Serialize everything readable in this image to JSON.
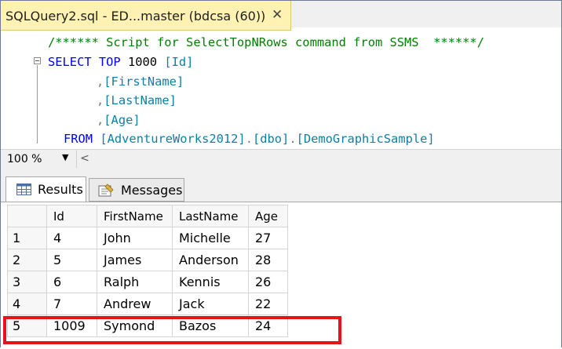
{
  "document_tab": {
    "title": "SQLQuery2.sql - ED...master (bdcsa (60))",
    "close_label": "✕"
  },
  "editor": {
    "lines": [
      {
        "parts": [
          {
            "cls": "cmt",
            "text": "/****** Script for SelectTopNRows command from SSMS  ******/"
          }
        ]
      },
      {
        "parts": [
          {
            "cls": "kw",
            "text": "SELECT"
          },
          {
            "cls": "plain",
            "text": " "
          },
          {
            "cls": "kw",
            "text": "TOP"
          },
          {
            "cls": "plain",
            "text": " 1000 "
          },
          {
            "cls": "br",
            "text": "[Id]"
          }
        ]
      },
      {
        "parts": [
          {
            "cls": "gray",
            "text": ","
          },
          {
            "cls": "br",
            "text": "[FirstName]"
          }
        ]
      },
      {
        "parts": [
          {
            "cls": "gray",
            "text": ","
          },
          {
            "cls": "br",
            "text": "[LastName]"
          }
        ]
      },
      {
        "parts": [
          {
            "cls": "gray",
            "text": ","
          },
          {
            "cls": "br",
            "text": "[Age]"
          }
        ]
      },
      {
        "parts": [
          {
            "cls": "kw",
            "text": "FROM"
          },
          {
            "cls": "plain",
            "text": " "
          },
          {
            "cls": "br",
            "text": "[AdventureWorks2012]"
          },
          {
            "cls": "gray",
            "text": "."
          },
          {
            "cls": "br",
            "text": "[dbo]"
          },
          {
            "cls": "gray",
            "text": "."
          },
          {
            "cls": "br",
            "text": "[DemoGraphicSample]"
          }
        ]
      }
    ]
  },
  "zoom": {
    "value": "100 %",
    "caret": "▼",
    "scroll_left": "<"
  },
  "results_tabs": {
    "results_label": "Results",
    "messages_label": "Messages"
  },
  "grid": {
    "columns": [
      "Id",
      "FirstName",
      "LastName",
      "Age"
    ],
    "rows": [
      {
        "rownum": "1",
        "cells": [
          "4",
          "John",
          "Michelle",
          "27"
        ]
      },
      {
        "rownum": "2",
        "cells": [
          "5",
          "James",
          "Anderson",
          "28"
        ]
      },
      {
        "rownum": "3",
        "cells": [
          "6",
          "Ralph",
          "Kennis",
          "26"
        ]
      },
      {
        "rownum": "4",
        "cells": [
          "7",
          "Andrew",
          "Jack",
          "22"
        ]
      },
      {
        "rownum": "5",
        "cells": [
          "1009",
          "Symond",
          "Bazos",
          "24"
        ]
      }
    ]
  },
  "colors": {
    "highlight": "#e8121b",
    "tab_active": "#fff2b3",
    "keyword": "#0000ff",
    "comment": "#008000",
    "identifier": "#0f7fa3"
  }
}
